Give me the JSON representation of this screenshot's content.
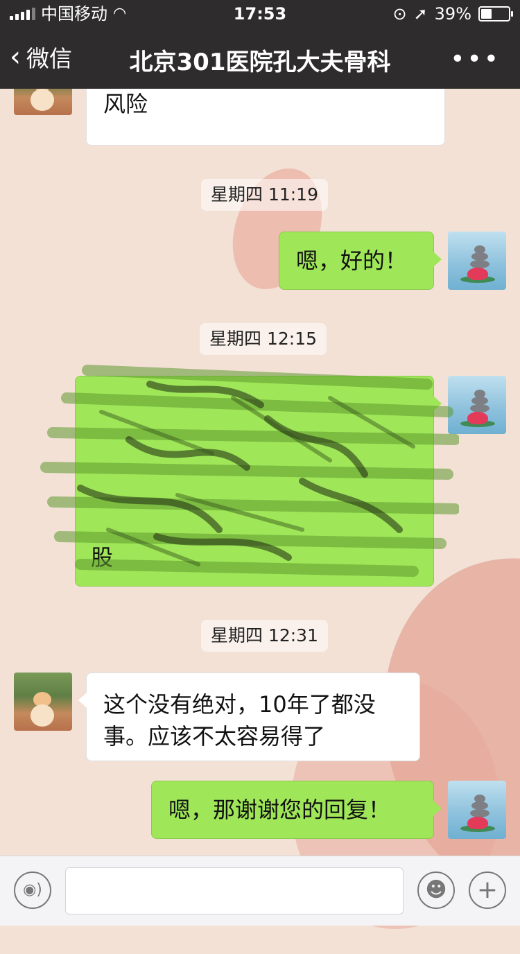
{
  "status_bar": {
    "carrier": "中国移动",
    "time": "17:53",
    "battery_percent": "39%",
    "battery_level": 0.39
  },
  "nav": {
    "back_label": "微信",
    "title": "北京301医院孔大夫骨科",
    "more_label": "•••"
  },
  "messages": [
    {
      "text": "嗯。等恢复了再做吧。没必要冒风险"
    },
    {
      "text": "嗯，好的！"
    },
    {
      "text": "股"
    },
    {
      "text": "这个没有绝对，10年了都没事。应该不太容易得了"
    },
    {
      "text": "嗯，那谢谢您的回复！"
    }
  ],
  "timestamps": [
    "星期四 11:19",
    "星期四 12:15",
    "星期四 12:31"
  ],
  "colors": {
    "header_bg": "#2e2c2c",
    "chat_bg": "#f3e1d6",
    "bubble_sent": "#9fe658",
    "bubble_received": "#ffffff"
  },
  "icons": {
    "signal": "signal-bars-icon",
    "wifi": "wifi-icon",
    "lock_rotation": "orientation-lock-icon",
    "location": "location-arrow-icon",
    "battery": "battery-icon",
    "back": "chevron-left-icon",
    "more": "more-dots-icon",
    "voice": "voice-icon",
    "emoji": "emoji-icon",
    "plus": "plus-icon"
  }
}
